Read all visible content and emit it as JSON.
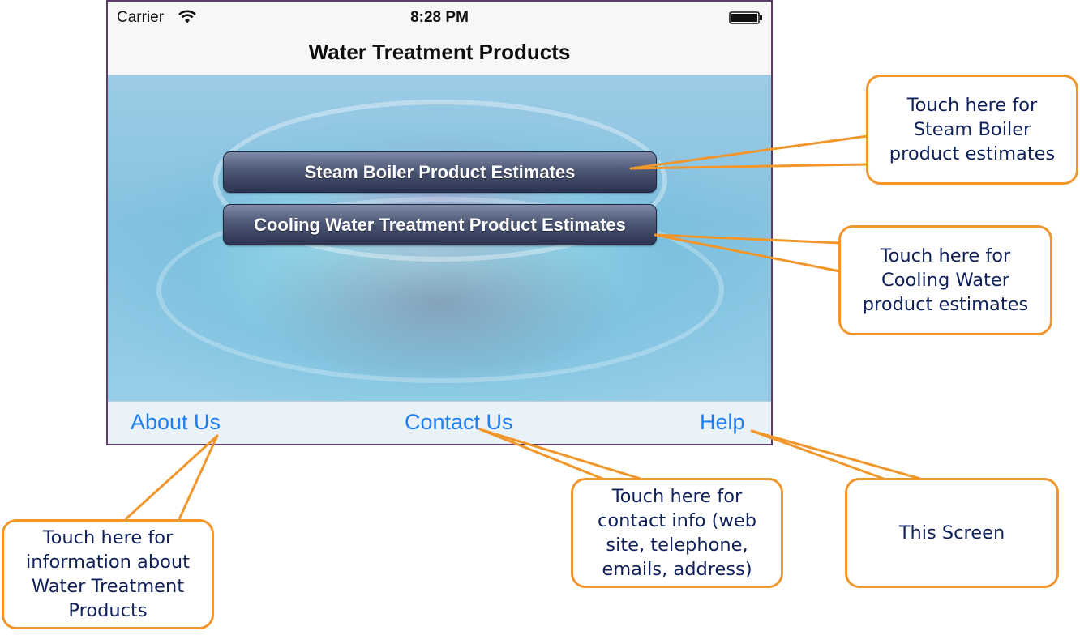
{
  "status_bar": {
    "carrier": "Carrier",
    "time": "8:28 PM"
  },
  "nav_bar": {
    "title": "Water Treatment Products"
  },
  "buttons": {
    "steam_boiler": "Steam Boiler Product Estimates",
    "cooling_water": "Cooling Water Treatment Product Estimates"
  },
  "toolbar": {
    "about": "About Us",
    "contact": "Contact Us",
    "help": "Help"
  },
  "callouts": {
    "steam_boiler": [
      "Touch here for",
      "Steam Boiler",
      "product estimates"
    ],
    "cooling_water": [
      "Touch here for",
      "Cooling Water",
      "product estimates"
    ],
    "about": [
      "Touch here for",
      "information about",
      "Water Treatment",
      "Products"
    ],
    "contact": [
      "Touch here for",
      "contact info (web",
      "site, telephone,",
      "emails, address)"
    ],
    "help": [
      "This Screen"
    ]
  },
  "colors": {
    "callout_border": "#f0962a",
    "callout_text": "#10205a",
    "link": "#1d7ef5"
  }
}
